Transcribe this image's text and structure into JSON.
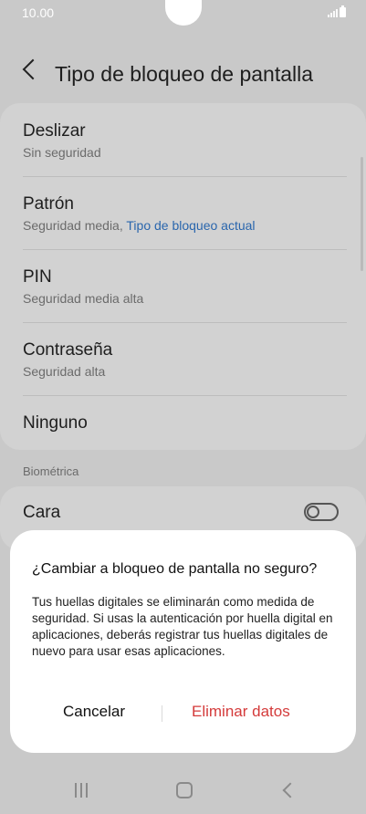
{
  "status_bar": {
    "time": "10.00"
  },
  "header": {
    "title": "Tipo de bloqueo de pantalla"
  },
  "lock_types": [
    {
      "title": "Deslizar",
      "subtitle": "Sin seguridad"
    },
    {
      "title": "Patrón",
      "subtitle": "Seguridad media,",
      "subtitle_highlight": "Tipo de bloqueo actual"
    },
    {
      "title": "PIN",
      "subtitle": "Seguridad media alta"
    },
    {
      "title": "Contraseña",
      "subtitle": "Seguridad alta"
    },
    {
      "title": "Ninguno"
    }
  ],
  "biometrics": {
    "section_label": "Biométrica",
    "face": {
      "label": "Cara",
      "enabled": false
    }
  },
  "dialog": {
    "title": "¿Cambiar a bloqueo de pantalla no seguro?",
    "body": "Tus huellas digitales se eliminarán como medida de seguridad. Si usas la autenticación por huella digital en aplicaciones, deberás registrar tus huellas digitales de nuevo para usar esas aplicaciones.",
    "cancel_label": "Cancelar",
    "confirm_label": "Eliminar datos",
    "confirm_color": "#d43b3b"
  },
  "icons": {
    "back": "back-arrow-icon",
    "recent": "recent-apps-icon",
    "home": "home-icon",
    "nav_back": "nav-back-icon"
  }
}
